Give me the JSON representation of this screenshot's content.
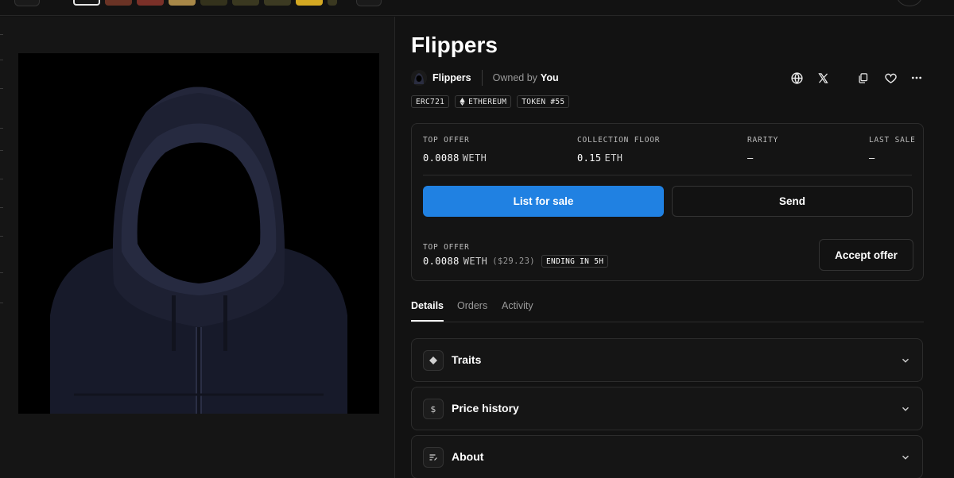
{
  "nft": {
    "title": "Flippers",
    "collection": "Flippers",
    "owned_label": "Owned by",
    "owner": "You"
  },
  "badges": [
    "ERC721",
    "ETHEREUM",
    "TOKEN #55"
  ],
  "stats": {
    "top_offer": {
      "label": "TOP OFFER",
      "value": "0.0088",
      "unit": "WETH"
    },
    "floor": {
      "label": "COLLECTION FLOOR",
      "value": "0.15",
      "unit": "ETH"
    },
    "rarity": {
      "label": "RARITY",
      "value": "–"
    },
    "last_sale": {
      "label": "LAST SALE",
      "value": "–"
    }
  },
  "actions": {
    "list_label": "List for sale",
    "send_label": "Send",
    "accept_label": "Accept offer"
  },
  "offer": {
    "label": "TOP OFFER",
    "value": "0.0088",
    "unit": "WETH",
    "usd": "($29.23)",
    "ending": "ENDING IN 5H"
  },
  "tabs": [
    "Details",
    "Orders",
    "Activity"
  ],
  "active_tab": "Details",
  "sections": [
    {
      "title": "Traits",
      "icon": "diamond-icon"
    },
    {
      "title": "Price history",
      "icon": "dollar-icon"
    },
    {
      "title": "About",
      "icon": "notes-icon"
    }
  ],
  "icons": [
    "globe-icon",
    "x-logo-icon",
    "copy-icon",
    "heart-icon",
    "more-icon"
  ],
  "colors": {
    "background": "#121212",
    "accent": "#2081e2",
    "border": "#2c2c2c",
    "muted_text": "#9a9a9a"
  }
}
